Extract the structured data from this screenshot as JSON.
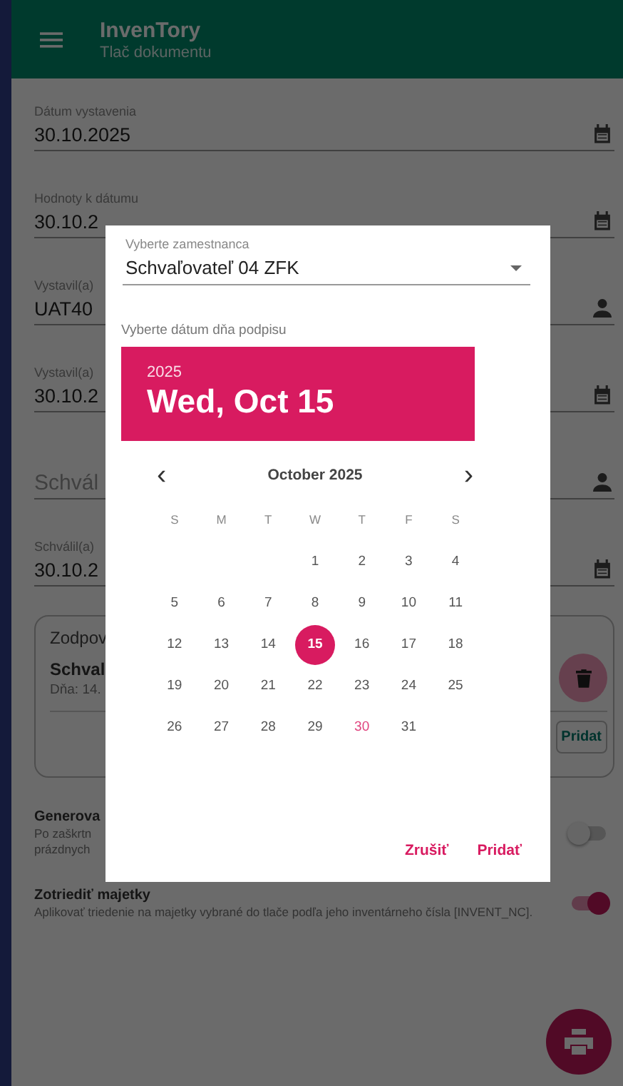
{
  "app_bar": {
    "title": "InvenTory",
    "subtitle": "Tlač dokumentu"
  },
  "fields": [
    {
      "kind": "date",
      "label": "Dátum vystavenia",
      "value": "30.10.2025"
    },
    {
      "kind": "date",
      "label": "Hodnoty k dátumu",
      "value": "30.10.2"
    },
    {
      "kind": "person",
      "label": "Vystavil(a)",
      "value": "UAT40"
    },
    {
      "kind": "date",
      "label": "Vystavil(a)",
      "value": "30.10.2"
    },
    {
      "kind": "person",
      "placeholder": "Schvál"
    },
    {
      "kind": "date",
      "label": "Schválil(a)",
      "value": "30.10.2"
    }
  ],
  "card": {
    "title": "Zodpov",
    "entry_name": "Schval",
    "entry_date": "Dňa: 14.",
    "add_button": "Pridat"
  },
  "switches": [
    {
      "title": "Generova",
      "description": [
        "Po zaškrtn",
        "prázdnych"
      ],
      "on": false
    },
    {
      "title": "Zotriediť majetky",
      "description": [
        "Aplikovať triedenie na majetky vybrané do tlače podľa jeho inventárneho čísla [INVENT_NC]."
      ],
      "on": true
    }
  ],
  "dialog": {
    "employee_label": "Vyberte zamestnanca",
    "employee_value": "Schvaľovateľ 04 ZFK",
    "date_label": "Vyberte dátum dňa podpisu",
    "header_year": "2025",
    "header_date": "Wed, Oct 15",
    "month": "October 2025",
    "prev": "‹",
    "next": "›",
    "weekdays": [
      "S",
      "M",
      "T",
      "W",
      "T",
      "F",
      "S"
    ],
    "weeks": [
      [
        {
          "day": "1",
          "selected": false,
          "today": false
        },
        {
          "day": "2",
          "selected": false,
          "today": false
        },
        {
          "day": "3",
          "selected": false,
          "today": false
        },
        {
          "day": "4",
          "selected": false,
          "today": false
        }
      ],
      [
        {
          "day": "5",
          "selected": false,
          "today": false
        },
        {
          "day": "6",
          "selected": false,
          "today": false
        },
        {
          "day": "7",
          "selected": false,
          "today": false
        },
        {
          "day": "8",
          "selected": false,
          "today": false
        },
        {
          "day": "9",
          "selected": false,
          "today": false
        },
        {
          "day": "10",
          "selected": false,
          "today": false
        },
        {
          "day": "11",
          "selected": false,
          "today": false
        }
      ],
      [
        {
          "day": "12",
          "selected": false,
          "today": false
        },
        {
          "day": "13",
          "selected": false,
          "today": false
        },
        {
          "day": "14",
          "selected": false,
          "today": false
        },
        {
          "day": "15",
          "selected": true,
          "today": false
        },
        {
          "day": "16",
          "selected": false,
          "today": false
        },
        {
          "day": "17",
          "selected": false,
          "today": false
        },
        {
          "day": "18",
          "selected": false,
          "today": false
        }
      ],
      [
        {
          "day": "19",
          "selected": false,
          "today": false
        },
        {
          "day": "20",
          "selected": false,
          "today": false
        },
        {
          "day": "21",
          "selected": false,
          "today": false
        },
        {
          "day": "22",
          "selected": false,
          "today": false
        },
        {
          "day": "23",
          "selected": false,
          "today": false
        },
        {
          "day": "24",
          "selected": false,
          "today": false
        },
        {
          "day": "25",
          "selected": false,
          "today": false
        }
      ],
      [
        {
          "day": "26",
          "selected": false,
          "today": false
        },
        {
          "day": "27",
          "selected": false,
          "today": false
        },
        {
          "day": "28",
          "selected": false,
          "today": false
        },
        {
          "day": "29",
          "selected": false,
          "today": false
        },
        {
          "day": "30",
          "selected": false,
          "today": true
        },
        {
          "day": "31",
          "selected": false,
          "today": false
        }
      ]
    ],
    "buttons": [
      "Zrušiť",
      "Pridať"
    ]
  }
}
